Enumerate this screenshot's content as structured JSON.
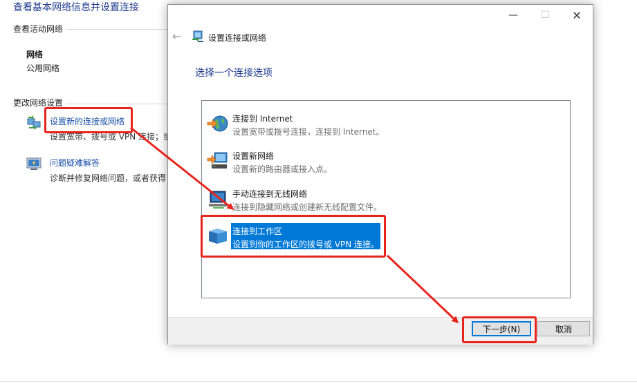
{
  "background": {
    "title": "查看基本网络信息并设置连接",
    "active_section": "查看活动网络",
    "network_name": "网络",
    "network_type": "公用网络",
    "change_section": "更改网络设置",
    "tasks": [
      {
        "link": "设置新的连接或网络",
        "desc": "设置宽带、拨号或 VPN 连接；或",
        "icon": "network-setup-icon"
      },
      {
        "link": "问题疑难解答",
        "desc": "诊断并修复网络问题，或者获得",
        "icon": "troubleshoot-icon"
      }
    ]
  },
  "dialog": {
    "title": "设置连接或网络",
    "heading": "选择一个连接选项",
    "options": [
      {
        "title": "连接到 Internet",
        "desc": "设置宽带或拨号连接，连接到 Internet。",
        "icon": "globe-icon"
      },
      {
        "title": "设置新网络",
        "desc": "设置新的路由器或接入点。",
        "icon": "router-icon"
      },
      {
        "title": "手动连接到无线网络",
        "desc": "连接到隐藏网络或创建新无线配置文件。",
        "icon": "wireless-icon"
      },
      {
        "title": "连接到工作区",
        "desc": "设置到你的工作区的拨号或 VPN 连接。",
        "icon": "workplace-icon"
      }
    ],
    "selected_index": 3,
    "buttons": {
      "next": "下一步(N)",
      "cancel": "取消"
    },
    "window_controls": {
      "minimize": "—",
      "maximize": "☐",
      "close": "✕"
    },
    "back_symbol": "←"
  },
  "colors": {
    "accent": "#0078d7",
    "heading": "#1e3b8f",
    "annotation": "#e8231b"
  }
}
